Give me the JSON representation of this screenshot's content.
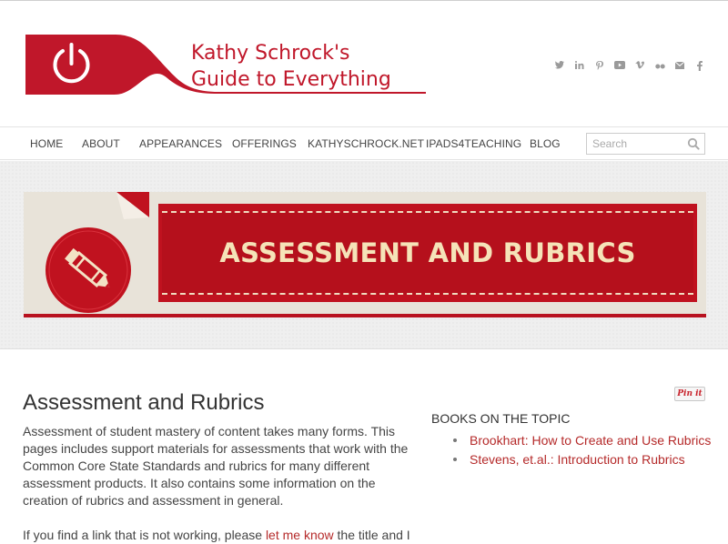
{
  "header": {
    "logo_line1": "Kathy Schrock's",
    "logo_line2": "Guide to Everything",
    "social_icons": [
      "twitter-icon",
      "linkedin-icon",
      "pinterest-icon",
      "youtube-icon",
      "vimeo-icon",
      "flickr-icon",
      "email-icon",
      "facebook-icon"
    ],
    "brand_color": "#c0172a"
  },
  "nav": {
    "items": [
      {
        "label": "HOME"
      },
      {
        "label": "ABOUT"
      },
      {
        "label": "APPEARANCES"
      },
      {
        "label": "OFFERINGS"
      },
      {
        "label": "KATHYSCHROCK.NET"
      },
      {
        "label": "IPADS4TEACHING"
      },
      {
        "label": "BLOG"
      }
    ],
    "search_placeholder": "Search"
  },
  "banner": {
    "title": "ASSESSMENT AND RUBRICS",
    "ribbon_color": "#c0121f",
    "text_color": "#f5e3b8"
  },
  "main": {
    "title": "Assessment and Rubrics",
    "paragraph1": "Assessment of student mastery of content takes many forms. This pages includes support materials for assessments that work with the Common Core State Standards and rubrics for many different assessment products. It also contains some information on the creation of rubrics and assessment in general.",
    "paragraph2_before": "If you find a link that is not working, please ",
    "paragraph2_link": "let me know",
    "paragraph2_after": " the title and I will fix"
  },
  "pinit": {
    "label": "Pin it"
  },
  "sidebar": {
    "heading": "BOOKS ON THE TOPIC",
    "links": [
      {
        "label": "Brookhart: How to Create and Use Rubrics"
      },
      {
        "label": "Stevens, et.al.: Introduction to Rubrics"
      }
    ],
    "link_color": "#b52a2a"
  }
}
